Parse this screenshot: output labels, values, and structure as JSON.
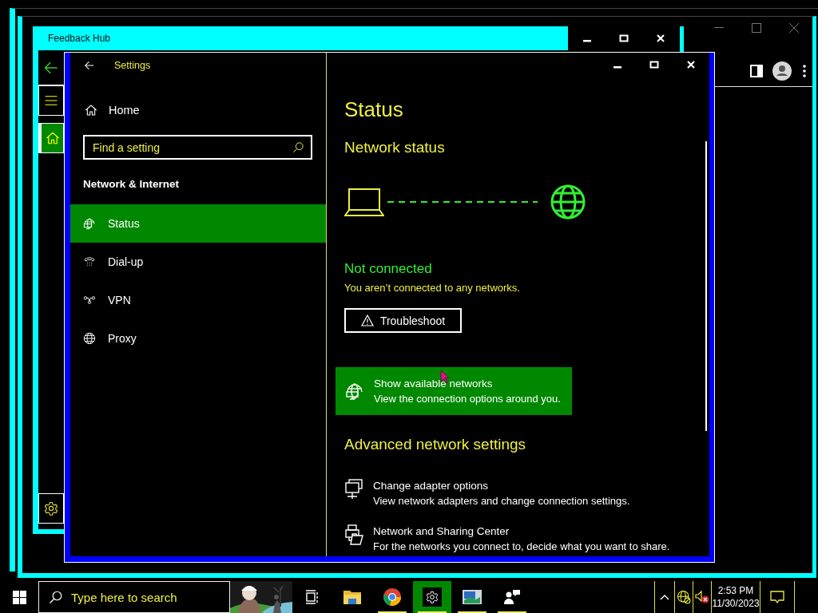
{
  "feedback_hub": {
    "title": "Feedback Hub",
    "nav": [
      {
        "kind": "menu",
        "selected": false
      },
      {
        "kind": "home",
        "selected": true
      }
    ]
  },
  "settings": {
    "title": "Settings",
    "home": "Home",
    "search": {
      "placeholder": "Find a setting"
    },
    "section": "Network & Internet",
    "nav": [
      {
        "kind": "status",
        "label": "Status",
        "selected": true
      },
      {
        "kind": "dialup",
        "label": "Dial-up",
        "selected": false
      },
      {
        "kind": "vpn",
        "label": "VPN",
        "selected": false
      },
      {
        "kind": "proxy",
        "label": "Proxy",
        "selected": false
      }
    ],
    "page": {
      "heading": "Status",
      "subheading": "Network status",
      "connection": {
        "state": "Not connected",
        "detail": "You aren’t connected to any networks."
      },
      "troubleshoot_button": "Troubleshoot",
      "show_networks": {
        "title": "Show available networks",
        "description": "View the connection options around you.",
        "hovered": true
      },
      "advanced_heading": "Advanced network settings",
      "advanced_items": [
        {
          "kind": "adapter",
          "title": "Change adapter options",
          "description": "View network adapters and change connection settings."
        },
        {
          "kind": "sharing",
          "title": "Network and Sharing Center",
          "description": "For the networks you connect to, decide what you want to share."
        }
      ]
    }
  },
  "taskbar": {
    "search": {
      "placeholder": "Type here to search"
    },
    "apps": [
      {
        "kind": "task-view",
        "running": false,
        "selected": false
      },
      {
        "kind": "explorer",
        "running": false,
        "selected": false
      },
      {
        "kind": "browser",
        "running": true,
        "selected": false
      },
      {
        "kind": "settings",
        "running": true,
        "selected": true
      },
      {
        "kind": "photos",
        "running": true,
        "selected": false
      },
      {
        "kind": "feedback",
        "running": true,
        "selected": false
      }
    ],
    "clock": {
      "time": "2:53 PM",
      "date": "11/30/2023"
    }
  }
}
